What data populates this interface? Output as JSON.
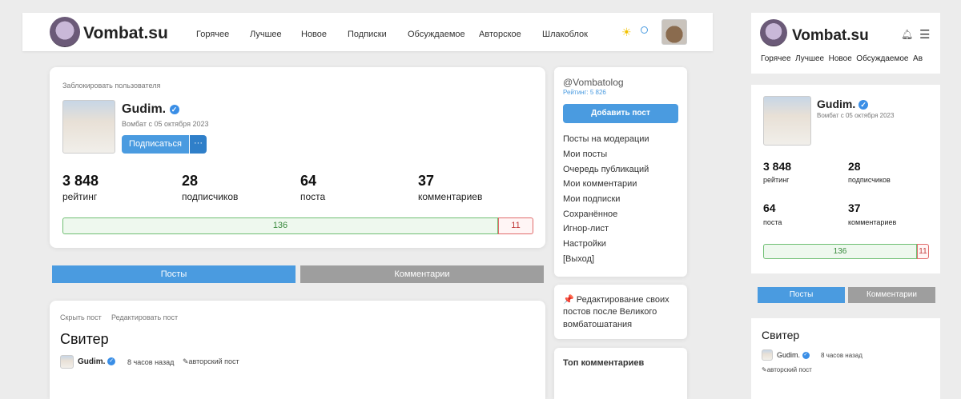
{
  "brand": {
    "name": "Vombat.su"
  },
  "nav": [
    "Горячее",
    "Лучшее",
    "Новое",
    "Подписки",
    "Обсуждаемое",
    "Авторское",
    "Шлакоблок"
  ],
  "icons": {
    "theme": "sun-icon",
    "search": "search-icon",
    "bell": "bell-icon",
    "menu": "hamburger-icon"
  },
  "profile": {
    "block_link": "Заблокировать пользователя",
    "name": "Gudim.",
    "since": "Вомбат с 05 октября 2023",
    "subscribe": "Подписаться",
    "more": "···",
    "stats": [
      {
        "value": "3 848",
        "label": "рейтинг"
      },
      {
        "value": "28",
        "label": "подписчиков"
      },
      {
        "value": "64",
        "label": "поста"
      },
      {
        "value": "37",
        "label": "комментариев"
      }
    ],
    "votes": {
      "plus": "136",
      "minus": "11"
    }
  },
  "tabs": {
    "posts": "Посты",
    "comments": "Комментарии"
  },
  "post": {
    "hide": "Скрыть пост",
    "edit": "Редактировать пост",
    "title": "Свитер",
    "author": "Gudim.",
    "time": "8 часов назад",
    "tag": "авторский пост"
  },
  "sidebar": {
    "user": "@Vombatolog",
    "rating": "Рейтинг: 5 826",
    "add_post": "Добавить пост",
    "menu": [
      "Посты на модерации",
      "Мои посты",
      "Очередь публикаций",
      "Мои комментарии",
      "Мои подписки",
      "Сохранённое",
      "Игнор-лист",
      "Настройки",
      "[Выход]"
    ],
    "notice_line1": "📌 Редактирование своих",
    "notice_line2": "постов после Великого",
    "notice_line3": "вомбатошатания",
    "top_comments": "Топ комментариев"
  },
  "mobile": {
    "nav": "Горячее  Лучшее  Новое  Обсуждаемое  Ав",
    "name": "Gudim.",
    "since": "Вомбат с 05 октября 2023",
    "stats": [
      {
        "value": "3 848",
        "label": "рейтинг"
      },
      {
        "value": "28",
        "label": "подписчиков"
      },
      {
        "value": "64",
        "label": "поста"
      },
      {
        "value": "37",
        "label": "комментариев"
      }
    ],
    "plus": "136",
    "minus": "11",
    "tab_posts": "Посты",
    "tab_comments": "Комментарии",
    "post_title": "Свитер",
    "author": "Gudim.",
    "time": "8 часов назад",
    "tag": "авторский пост"
  }
}
